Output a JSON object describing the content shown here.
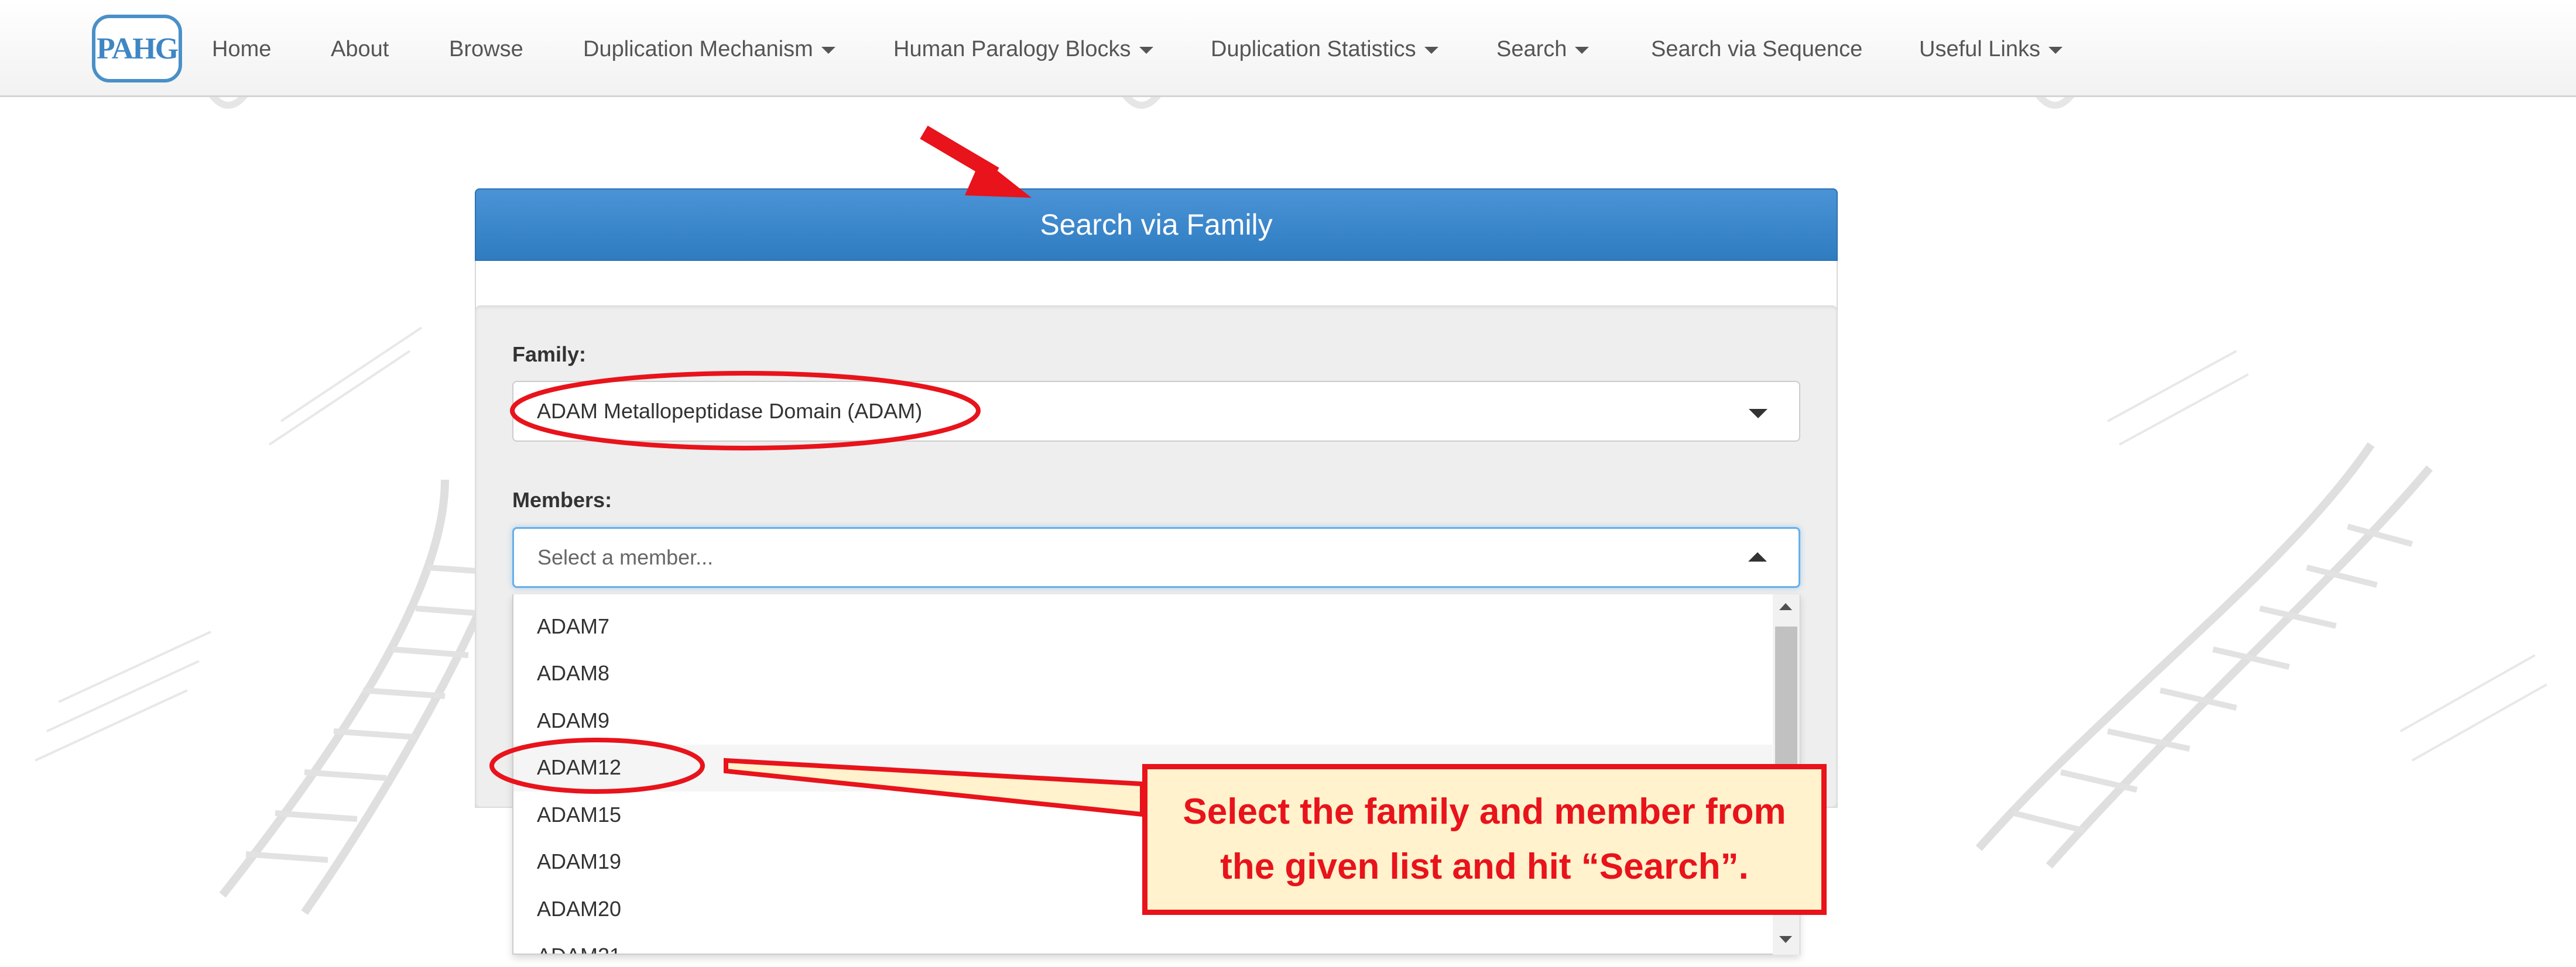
{
  "logo": {
    "text": "PAHG"
  },
  "nav": {
    "home": "Home",
    "about": "About",
    "browse": "Browse",
    "duplication_mechanism": "Duplication Mechanism",
    "human_paralogy_blocks": "Human Paralogy Blocks",
    "duplication_statistics": "Duplication Statistics",
    "search": "Search",
    "search_via_sequence": "Search via Sequence",
    "useful_links": "Useful Links"
  },
  "panel": {
    "title": "Search via Family"
  },
  "form": {
    "family_label": "Family:",
    "family_value": "ADAM Metallopeptidase Domain (ADAM)",
    "members_label": "Members:",
    "members_placeholder": "Select a member..."
  },
  "members_options": [
    "ADAM7",
    "ADAM8",
    "ADAM9",
    "ADAM12",
    "ADAM15",
    "ADAM19",
    "ADAM20",
    "ADAM21"
  ],
  "callout": {
    "line1": "Select the family and member from",
    "line2": "the given list and hit “Search”."
  },
  "colors": {
    "accent": "#3a87cb",
    "annotation_red": "#e8131b",
    "callout_fill": "#fff2cc"
  }
}
